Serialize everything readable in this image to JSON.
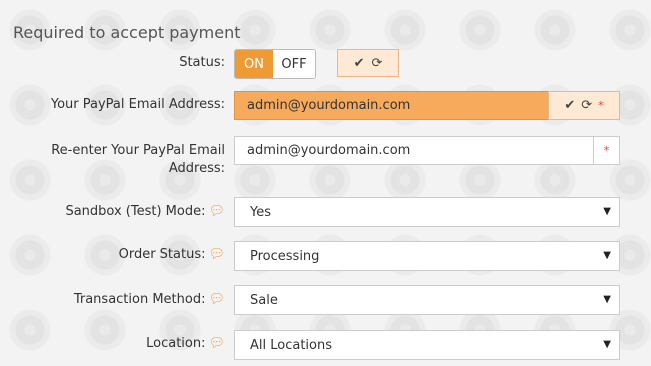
{
  "section_title": "Required to accept payment",
  "status": {
    "label": "Status:",
    "on": "ON",
    "off": "OFF",
    "icons": [
      "check-icon",
      "refresh-icon"
    ]
  },
  "email": {
    "label": "Your PayPal Email Address:",
    "value": "admin@yourdomain.com",
    "required": "*"
  },
  "email_confirm": {
    "label": "Re-enter Your PayPal Email Address:",
    "value": "admin@yourdomain.com",
    "required": "*"
  },
  "sandbox": {
    "label": "Sandbox (Test) Mode:",
    "value": "Yes"
  },
  "order_status": {
    "label": "Order Status:",
    "value": "Processing"
  },
  "transaction": {
    "label": "Transaction Method:",
    "value": "Sale"
  },
  "location": {
    "label": "Location:",
    "value": "All Locations"
  },
  "colors": {
    "accent": "#f09a34",
    "highlight": "#f7a95c",
    "addon_bg": "#fde9d4",
    "required": "#e04040"
  }
}
